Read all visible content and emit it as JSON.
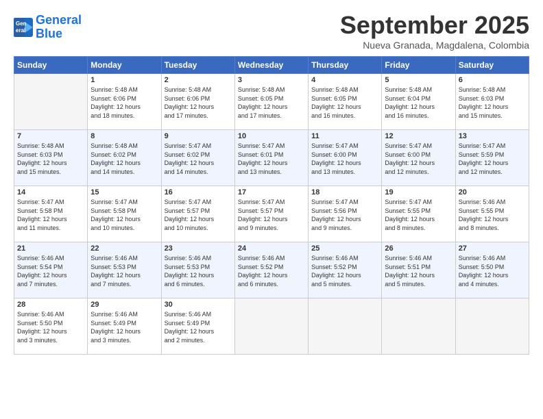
{
  "logo": {
    "line1": "General",
    "line2": "Blue"
  },
  "title": "September 2025",
  "subtitle": "Nueva Granada, Magdalena, Colombia",
  "days_of_week": [
    "Sunday",
    "Monday",
    "Tuesday",
    "Wednesday",
    "Thursday",
    "Friday",
    "Saturday"
  ],
  "weeks": [
    [
      {
        "day": "",
        "sunrise": "",
        "sunset": "",
        "daylight": ""
      },
      {
        "day": "1",
        "sunrise": "Sunrise: 5:48 AM",
        "sunset": "Sunset: 6:06 PM",
        "daylight": "Daylight: 12 hours and 18 minutes."
      },
      {
        "day": "2",
        "sunrise": "Sunrise: 5:48 AM",
        "sunset": "Sunset: 6:06 PM",
        "daylight": "Daylight: 12 hours and 17 minutes."
      },
      {
        "day": "3",
        "sunrise": "Sunrise: 5:48 AM",
        "sunset": "Sunset: 6:05 PM",
        "daylight": "Daylight: 12 hours and 17 minutes."
      },
      {
        "day": "4",
        "sunrise": "Sunrise: 5:48 AM",
        "sunset": "Sunset: 6:05 PM",
        "daylight": "Daylight: 12 hours and 16 minutes."
      },
      {
        "day": "5",
        "sunrise": "Sunrise: 5:48 AM",
        "sunset": "Sunset: 6:04 PM",
        "daylight": "Daylight: 12 hours and 16 minutes."
      },
      {
        "day": "6",
        "sunrise": "Sunrise: 5:48 AM",
        "sunset": "Sunset: 6:03 PM",
        "daylight": "Daylight: 12 hours and 15 minutes."
      }
    ],
    [
      {
        "day": "7",
        "sunrise": "Sunrise: 5:48 AM",
        "sunset": "Sunset: 6:03 PM",
        "daylight": "Daylight: 12 hours and 15 minutes."
      },
      {
        "day": "8",
        "sunrise": "Sunrise: 5:48 AM",
        "sunset": "Sunset: 6:02 PM",
        "daylight": "Daylight: 12 hours and 14 minutes."
      },
      {
        "day": "9",
        "sunrise": "Sunrise: 5:47 AM",
        "sunset": "Sunset: 6:02 PM",
        "daylight": "Daylight: 12 hours and 14 minutes."
      },
      {
        "day": "10",
        "sunrise": "Sunrise: 5:47 AM",
        "sunset": "Sunset: 6:01 PM",
        "daylight": "Daylight: 12 hours and 13 minutes."
      },
      {
        "day": "11",
        "sunrise": "Sunrise: 5:47 AM",
        "sunset": "Sunset: 6:00 PM",
        "daylight": "Daylight: 12 hours and 13 minutes."
      },
      {
        "day": "12",
        "sunrise": "Sunrise: 5:47 AM",
        "sunset": "Sunset: 6:00 PM",
        "daylight": "Daylight: 12 hours and 12 minutes."
      },
      {
        "day": "13",
        "sunrise": "Sunrise: 5:47 AM",
        "sunset": "Sunset: 5:59 PM",
        "daylight": "Daylight: 12 hours and 12 minutes."
      }
    ],
    [
      {
        "day": "14",
        "sunrise": "Sunrise: 5:47 AM",
        "sunset": "Sunset: 5:58 PM",
        "daylight": "Daylight: 12 hours and 11 minutes."
      },
      {
        "day": "15",
        "sunrise": "Sunrise: 5:47 AM",
        "sunset": "Sunset: 5:58 PM",
        "daylight": "Daylight: 12 hours and 10 minutes."
      },
      {
        "day": "16",
        "sunrise": "Sunrise: 5:47 AM",
        "sunset": "Sunset: 5:57 PM",
        "daylight": "Daylight: 12 hours and 10 minutes."
      },
      {
        "day": "17",
        "sunrise": "Sunrise: 5:47 AM",
        "sunset": "Sunset: 5:57 PM",
        "daylight": "Daylight: 12 hours and 9 minutes."
      },
      {
        "day": "18",
        "sunrise": "Sunrise: 5:47 AM",
        "sunset": "Sunset: 5:56 PM",
        "daylight": "Daylight: 12 hours and 9 minutes."
      },
      {
        "day": "19",
        "sunrise": "Sunrise: 5:47 AM",
        "sunset": "Sunset: 5:55 PM",
        "daylight": "Daylight: 12 hours and 8 minutes."
      },
      {
        "day": "20",
        "sunrise": "Sunrise: 5:46 AM",
        "sunset": "Sunset: 5:55 PM",
        "daylight": "Daylight: 12 hours and 8 minutes."
      }
    ],
    [
      {
        "day": "21",
        "sunrise": "Sunrise: 5:46 AM",
        "sunset": "Sunset: 5:54 PM",
        "daylight": "Daylight: 12 hours and 7 minutes."
      },
      {
        "day": "22",
        "sunrise": "Sunrise: 5:46 AM",
        "sunset": "Sunset: 5:53 PM",
        "daylight": "Daylight: 12 hours and 7 minutes."
      },
      {
        "day": "23",
        "sunrise": "Sunrise: 5:46 AM",
        "sunset": "Sunset: 5:53 PM",
        "daylight": "Daylight: 12 hours and 6 minutes."
      },
      {
        "day": "24",
        "sunrise": "Sunrise: 5:46 AM",
        "sunset": "Sunset: 5:52 PM",
        "daylight": "Daylight: 12 hours and 6 minutes."
      },
      {
        "day": "25",
        "sunrise": "Sunrise: 5:46 AM",
        "sunset": "Sunset: 5:52 PM",
        "daylight": "Daylight: 12 hours and 5 minutes."
      },
      {
        "day": "26",
        "sunrise": "Sunrise: 5:46 AM",
        "sunset": "Sunset: 5:51 PM",
        "daylight": "Daylight: 12 hours and 5 minutes."
      },
      {
        "day": "27",
        "sunrise": "Sunrise: 5:46 AM",
        "sunset": "Sunset: 5:50 PM",
        "daylight": "Daylight: 12 hours and 4 minutes."
      }
    ],
    [
      {
        "day": "28",
        "sunrise": "Sunrise: 5:46 AM",
        "sunset": "Sunset: 5:50 PM",
        "daylight": "Daylight: 12 hours and 3 minutes."
      },
      {
        "day": "29",
        "sunrise": "Sunrise: 5:46 AM",
        "sunset": "Sunset: 5:49 PM",
        "daylight": "Daylight: 12 hours and 3 minutes."
      },
      {
        "day": "30",
        "sunrise": "Sunrise: 5:46 AM",
        "sunset": "Sunset: 5:49 PM",
        "daylight": "Daylight: 12 hours and 2 minutes."
      },
      {
        "day": "",
        "sunrise": "",
        "sunset": "",
        "daylight": ""
      },
      {
        "day": "",
        "sunrise": "",
        "sunset": "",
        "daylight": ""
      },
      {
        "day": "",
        "sunrise": "",
        "sunset": "",
        "daylight": ""
      },
      {
        "day": "",
        "sunrise": "",
        "sunset": "",
        "daylight": ""
      }
    ]
  ]
}
